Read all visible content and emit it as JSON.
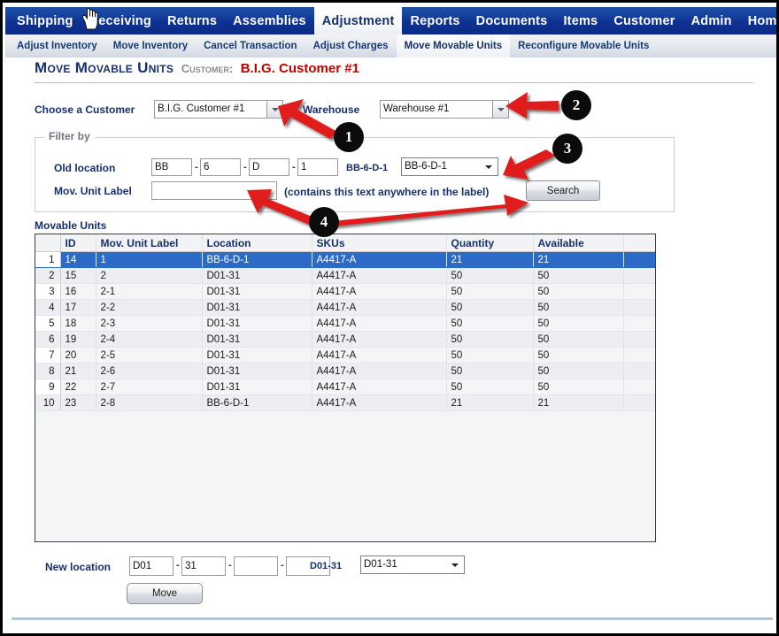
{
  "window": {
    "main_nav": [
      {
        "label": "Shipping",
        "active": false
      },
      {
        "label": "Receiving",
        "active": false
      },
      {
        "label": "Returns",
        "active": false
      },
      {
        "label": "Assemblies",
        "active": false
      },
      {
        "label": "Adjustment",
        "active": true
      },
      {
        "label": "Reports",
        "active": false
      },
      {
        "label": "Documents",
        "active": false
      },
      {
        "label": "Items",
        "active": false
      },
      {
        "label": "Customer",
        "active": false
      },
      {
        "label": "Admin",
        "active": false
      },
      {
        "label": "Home",
        "active": false
      }
    ],
    "sub_nav": [
      {
        "label": "Adjust Inventory",
        "active": false
      },
      {
        "label": "Move Inventory",
        "active": false
      },
      {
        "label": "Cancel Transaction",
        "active": false
      },
      {
        "label": "Adjust Charges",
        "active": false
      },
      {
        "label": "Move Movable Units",
        "active": true
      },
      {
        "label": "Reconfigure Movable Units",
        "active": false
      }
    ],
    "nav_colors": {
      "main_nav_bg": "#0d3192",
      "main_nav_text": "#ffffff",
      "active_tab_bg": "#ffffff",
      "active_tab_text": "#16306e",
      "sub_nav_text": "#173a78"
    }
  },
  "page": {
    "title": "Move Movable Units",
    "customer_label": "Customer:",
    "customer_value": "B.I.G. Customer #1",
    "title_color": "#16306e",
    "customer_value_color": "#c00000"
  },
  "customer_row": {
    "choose_customer_label": "Choose a Customer",
    "customer_select_value": "B.I.G. Customer #1",
    "warehouse_label": "Warehouse",
    "warehouse_select_value": "Warehouse #1"
  },
  "filter": {
    "legend": "Filter by",
    "old_location_label": "Old location",
    "old_location_parts": [
      "BB",
      "6",
      "D",
      "1"
    ],
    "old_location_separator": "-",
    "old_location_code": "BB-6-D-1",
    "old_location_select_value": "BB-6-D-1",
    "mov_unit_label": "Mov. Unit Label",
    "mov_unit_value": "",
    "mov_unit_placeholder": "",
    "hint": "(contains this text anywhere in the label)",
    "search_button": "Search"
  },
  "grid": {
    "caption": "Movable Units",
    "columns": [
      "",
      "ID",
      "Mov. Unit Label",
      "Location",
      "SKUs",
      "Quantity",
      "Available",
      ""
    ],
    "rows": [
      {
        "n": "1",
        "id": "14",
        "label": "1",
        "location": "BB-6-D-1",
        "skus": "A4417-A",
        "quantity": "21",
        "available": "21",
        "selected": true
      },
      {
        "n": "2",
        "id": "15",
        "label": "2",
        "location": "D01-31",
        "skus": "A4417-A",
        "quantity": "50",
        "available": "50",
        "selected": false
      },
      {
        "n": "3",
        "id": "16",
        "label": "2-1",
        "location": "D01-31",
        "skus": "A4417-A",
        "quantity": "50",
        "available": "50",
        "selected": false
      },
      {
        "n": "4",
        "id": "17",
        "label": "2-2",
        "location": "D01-31",
        "skus": "A4417-A",
        "quantity": "50",
        "available": "50",
        "selected": false
      },
      {
        "n": "5",
        "id": "18",
        "label": "2-3",
        "location": "D01-31",
        "skus": "A4417-A",
        "quantity": "50",
        "available": "50",
        "selected": false
      },
      {
        "n": "6",
        "id": "19",
        "label": "2-4",
        "location": "D01-31",
        "skus": "A4417-A",
        "quantity": "50",
        "available": "50",
        "selected": false
      },
      {
        "n": "7",
        "id": "20",
        "label": "2-5",
        "location": "D01-31",
        "skus": "A4417-A",
        "quantity": "50",
        "available": "50",
        "selected": false
      },
      {
        "n": "8",
        "id": "21",
        "label": "2-6",
        "location": "D01-31",
        "skus": "A4417-A",
        "quantity": "50",
        "available": "50",
        "selected": false
      },
      {
        "n": "9",
        "id": "22",
        "label": "2-7",
        "location": "D01-31",
        "skus": "A4417-A",
        "quantity": "50",
        "available": "50",
        "selected": false
      },
      {
        "n": "10",
        "id": "23",
        "label": "2-8",
        "location": "BB-6-D-1",
        "skus": "A4417-A",
        "quantity": "21",
        "available": "21",
        "selected": false
      }
    ],
    "selected_row_color": "#2a6ac8"
  },
  "new_location": {
    "label": "New location",
    "parts": [
      "D01",
      "31",
      "",
      ""
    ],
    "separator": "-",
    "code": "D01-31",
    "select_value": "D01-31",
    "move_button": "Move"
  },
  "annotations": {
    "color": "#e01b1b",
    "items": [
      {
        "number": "1"
      },
      {
        "number": "2"
      },
      {
        "number": "3"
      },
      {
        "number": "4"
      }
    ]
  }
}
